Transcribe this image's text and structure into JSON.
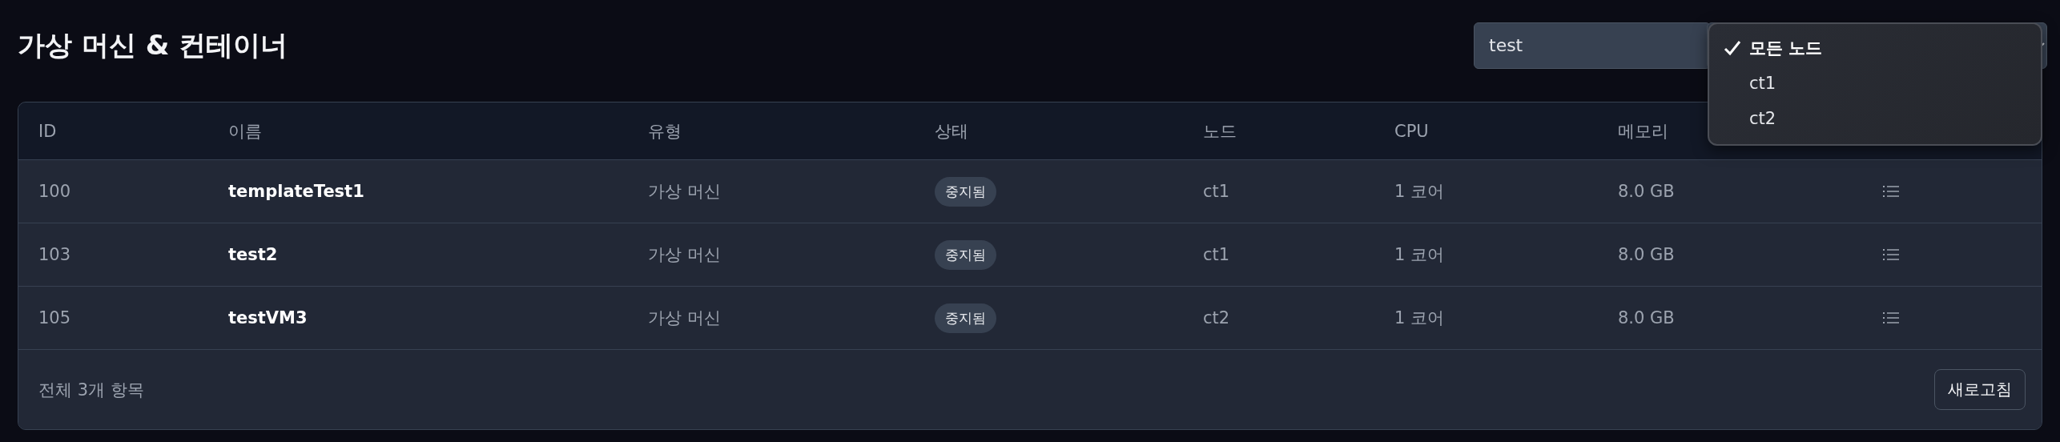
{
  "title": "가상 머신 & 컨테이너",
  "search": {
    "value": "test"
  },
  "node_menu": {
    "options": [
      {
        "label": "모든 노드",
        "selected": true
      },
      {
        "label": "ct1",
        "selected": false
      },
      {
        "label": "ct2",
        "selected": false
      }
    ]
  },
  "table": {
    "columns": [
      "ID",
      "이름",
      "유형",
      "상태",
      "노드",
      "CPU",
      "메모리"
    ],
    "rows": [
      {
        "id": "100",
        "name": "templateTest1",
        "type": "가상 머신",
        "status": "중지됨",
        "node": "ct1",
        "cpu": "1 코어",
        "memory": "8.0 GB"
      },
      {
        "id": "103",
        "name": "test2",
        "type": "가상 머신",
        "status": "중지됨",
        "node": "ct1",
        "cpu": "1 코어",
        "memory": "8.0 GB"
      },
      {
        "id": "105",
        "name": "testVM3",
        "type": "가상 머신",
        "status": "중지됨",
        "node": "ct2",
        "cpu": "1 코어",
        "memory": "8.0 GB"
      }
    ],
    "footer": {
      "count": "전체 3개 항목",
      "refresh": "새로고침"
    }
  }
}
